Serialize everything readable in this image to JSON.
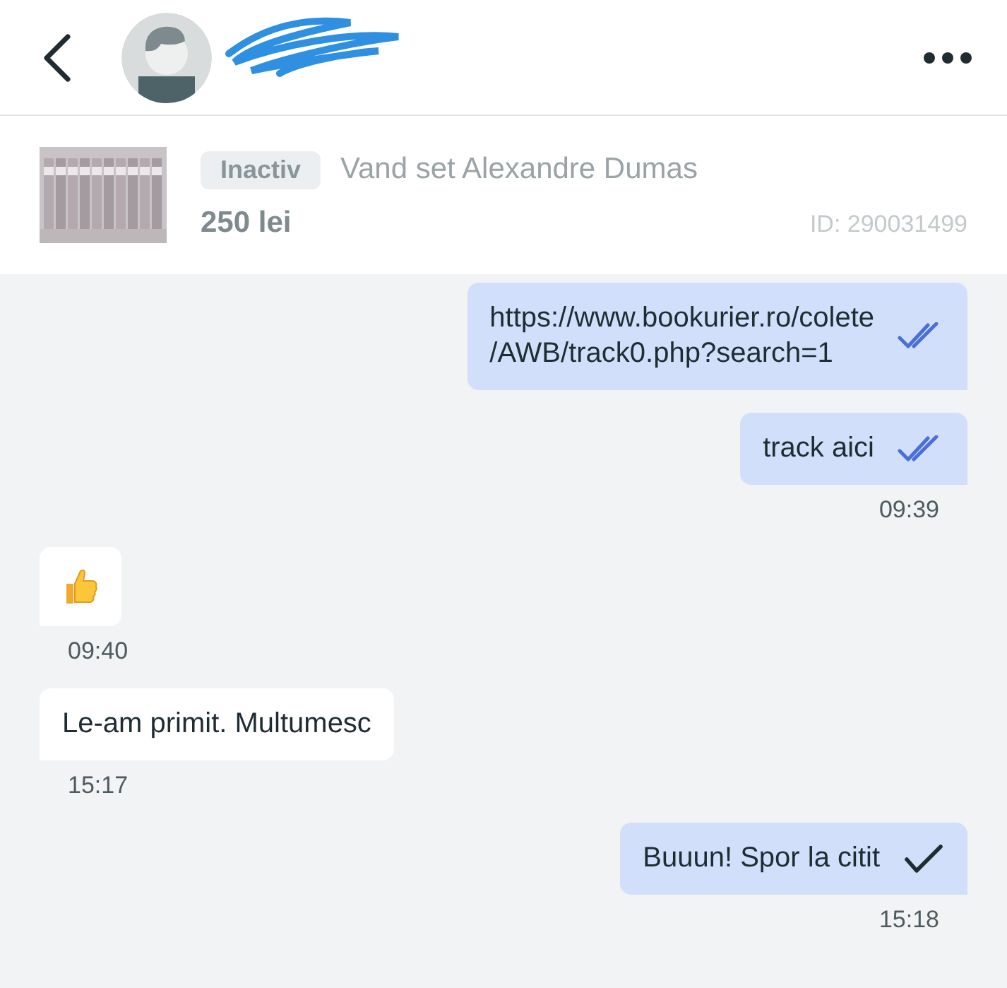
{
  "listing": {
    "status": "Inactiv",
    "title": "Vand set Alexandre Dumas",
    "price": "250 lei",
    "id": "ID: 290031499"
  },
  "messages": [
    {
      "kind": "text",
      "outgoing": true,
      "lines": [
        "https://www.bookurier.ro/colete",
        "/AWB/track0.php?search=1"
      ],
      "read": true
    },
    {
      "kind": "text",
      "outgoing": true,
      "lines": [
        "track aici"
      ],
      "read": true,
      "time": "09:39"
    },
    {
      "kind": "emoji",
      "outgoing": false,
      "time": "09:40"
    },
    {
      "kind": "text",
      "outgoing": false,
      "lines": [
        "Le-am primit. Multumesc"
      ],
      "time": "15:17"
    },
    {
      "kind": "text",
      "outgoing": true,
      "lines": [
        "Buuun! Spor la citit"
      ],
      "read": false,
      "time": "15:18"
    }
  ]
}
